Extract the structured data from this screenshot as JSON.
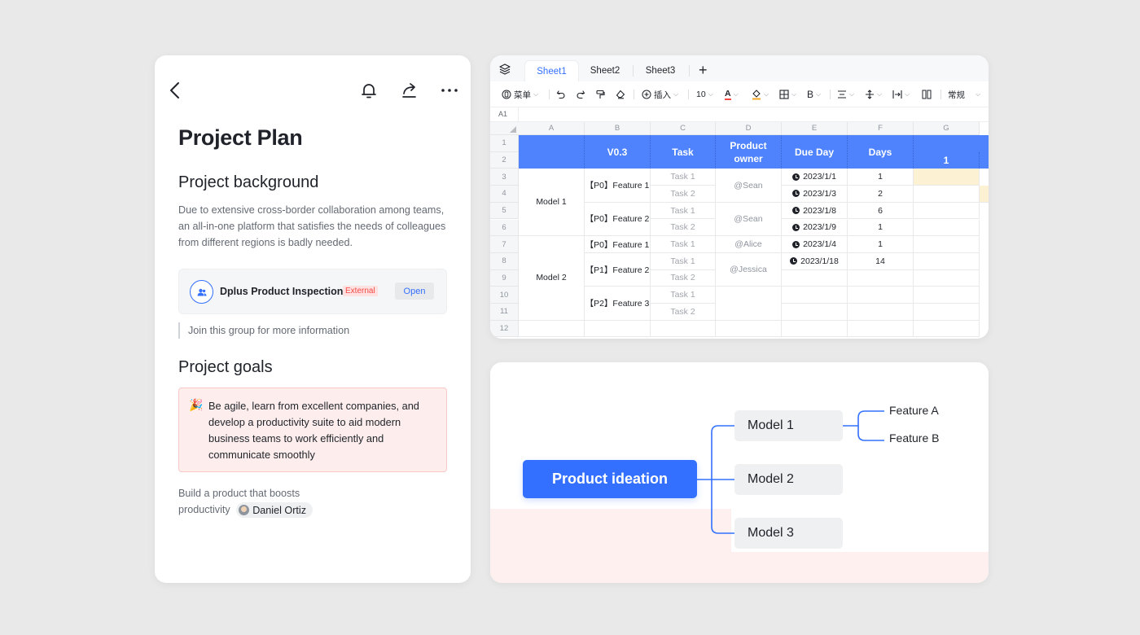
{
  "doc": {
    "title": "Project Plan",
    "icons": {
      "back": "chevron-left-icon",
      "bell": "bell-icon",
      "share": "share-icon",
      "more": "more-icon"
    },
    "background_heading": "Project background",
    "background_text": "Due to extensive cross-border collaboration among teams, an all-in-one platform that satisfies the needs of colleagues from different regions is badly needed.",
    "group": {
      "name": "Dplus Product Inspection",
      "badge": "External",
      "open_label": "Open",
      "icon": "group-icon"
    },
    "quote": "Join this group for more information",
    "goals_heading": "Project goals",
    "callout": {
      "icon": "party-popper-icon",
      "emoji": "🎉",
      "text": "Be agile, learn from excellent companies, and develop a productivity suite to aid modern business teams to work efficiently and communicate smoothly"
    },
    "goal_text": "Build a product that boosts productivity",
    "mention": "Daniel Ortiz"
  },
  "sheet": {
    "tabs": [
      {
        "label": "Sheet1",
        "active": true
      },
      {
        "label": "Sheet2",
        "active": false
      },
      {
        "label": "Sheet3",
        "active": false
      }
    ],
    "add_tab": "+",
    "toolbar": {
      "menu_label": "菜单",
      "insert_label": "插入",
      "font_size": "10",
      "format_label": "常规"
    },
    "cell_ref": "A1",
    "columns": [
      "A",
      "B",
      "C",
      "D",
      "E",
      "F",
      "G"
    ],
    "rows": [
      "1",
      "2",
      "3",
      "4",
      "5",
      "6",
      "7",
      "8",
      "9",
      "10",
      "11",
      "12"
    ],
    "header": {
      "version": "V0.3",
      "task": "Task",
      "owner": "Product owner",
      "due": "Due Day",
      "days": "Days",
      "g": "1"
    },
    "models": [
      "Model 1",
      "Model 2"
    ],
    "features": [
      "【P0】Feature 1",
      "【P0】Feature 2",
      "【P0】Feature 1",
      "【P1】Feature 2",
      "【P2】Feature 3"
    ],
    "tasks": [
      "Task 1",
      "Task 2",
      "Task 1",
      "Task 2",
      "Task 1",
      "Task 1",
      "Task 2",
      "Task 1",
      "Task 2"
    ],
    "owners": [
      "@Sean",
      "@Sean",
      "@Alice",
      "@Jessica"
    ],
    "due_dates": [
      "2023/1/1",
      "2023/1/3",
      "2023/1/8",
      "2023/1/9",
      "2023/1/4",
      "2023/1/18"
    ],
    "days": [
      "1",
      "2",
      "6",
      "1",
      "1",
      "14"
    ],
    "colors": {
      "header_blue": "#4e83fd",
      "highlight_yellow": "#fdf1d3"
    }
  },
  "mindmap": {
    "root": "Product ideation",
    "models": [
      "Model 1",
      "Model 2",
      "Model 3"
    ],
    "features": [
      "Feature A",
      "Feature B"
    ],
    "colors": {
      "root": "#3370ff",
      "line": "#3370ff",
      "node": "#eff0f1"
    }
  }
}
